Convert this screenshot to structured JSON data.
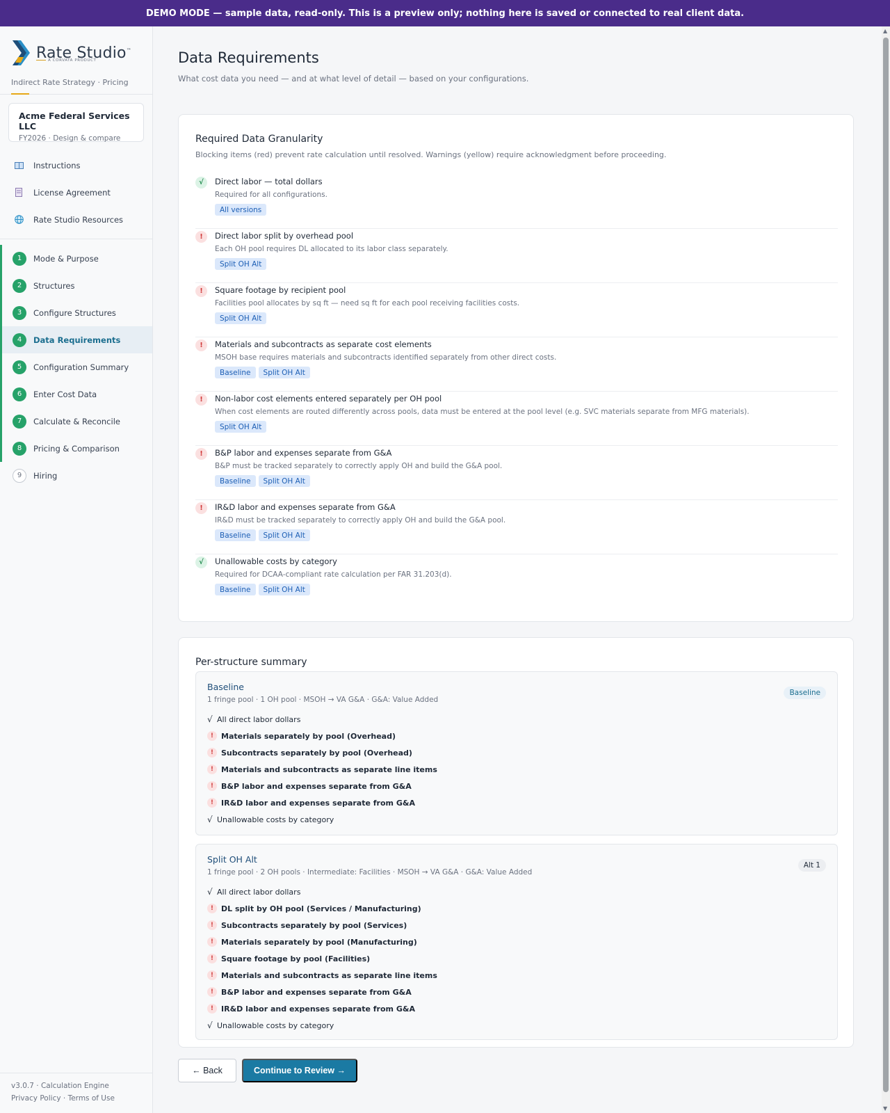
{
  "banner": "DEMO MODE — sample data, read-only. This is a preview only; nothing here is saved or connected to real client data.",
  "brand": {
    "name": "Rate Studio",
    "tm": "™",
    "sub": "A CORVATA PRODUCT",
    "tagline": "Indirect Rate Strategy · Pricing"
  },
  "client": {
    "name": "Acme Federal Services LLC",
    "sub": "FY2026 · Design & compare"
  },
  "resources": [
    {
      "label": "Instructions",
      "icon": "book-icon"
    },
    {
      "label": "License Agreement",
      "icon": "document-icon"
    },
    {
      "label": "Rate Studio Resources",
      "icon": "globe-icon"
    }
  ],
  "steps": [
    {
      "num": "1",
      "label": "Mode & Purpose"
    },
    {
      "num": "2",
      "label": "Structures"
    },
    {
      "num": "3",
      "label": "Configure Structures"
    },
    {
      "num": "4",
      "label": "Data Requirements"
    },
    {
      "num": "5",
      "label": "Configuration Summary"
    },
    {
      "num": "6",
      "label": "Enter Cost Data"
    },
    {
      "num": "7",
      "label": "Calculate & Reconcile"
    },
    {
      "num": "8",
      "label": "Pricing & Comparison"
    },
    {
      "num": "9",
      "label": "Hiring"
    }
  ],
  "footer": {
    "version": "v3.0.7 · Calculation Engine",
    "privacy": "Privacy Policy",
    "sep": "·",
    "terms": "Terms of Use"
  },
  "page": {
    "title": "Data Requirements",
    "subtitle": "What cost data you need — and at what level of detail — based on your configurations."
  },
  "granularity": {
    "title": "Required Data Granularity",
    "desc": "Blocking items (red) prevent rate calculation until resolved. Warnings (yellow) require acknowledgment before proceeding.",
    "items": [
      {
        "status": "ok",
        "mark": "√",
        "title": "Direct labor — total dollars",
        "desc": "Required for all configurations.",
        "tags": [
          "All versions"
        ]
      },
      {
        "status": "bad",
        "mark": "!",
        "title": "Direct labor split by overhead pool",
        "desc": "Each OH pool requires DL allocated to its labor class separately.",
        "tags": [
          "Split OH Alt"
        ]
      },
      {
        "status": "bad",
        "mark": "!",
        "title": "Square footage by recipient pool",
        "desc": "Facilities pool allocates by sq ft — need sq ft for each pool receiving facilities costs.",
        "tags": [
          "Split OH Alt"
        ]
      },
      {
        "status": "bad",
        "mark": "!",
        "title": "Materials and subcontracts as separate cost elements",
        "desc": "MSOH base requires materials and subcontracts identified separately from other direct costs.",
        "tags": [
          "Baseline",
          "Split OH Alt"
        ]
      },
      {
        "status": "bad",
        "mark": "!",
        "title": "Non-labor cost elements entered separately per OH pool",
        "desc": "When cost elements are routed differently across pools, data must be entered at the pool level (e.g. SVC materials separate from MFG materials).",
        "tags": [
          "Split OH Alt"
        ]
      },
      {
        "status": "bad",
        "mark": "!",
        "title": "B&P labor and expenses separate from G&A",
        "desc": "B&P must be tracked separately to correctly apply OH and build the G&A pool.",
        "tags": [
          "Baseline",
          "Split OH Alt"
        ]
      },
      {
        "status": "bad",
        "mark": "!",
        "title": "IR&D labor and expenses separate from G&A",
        "desc": "IR&D must be tracked separately to correctly apply OH and build the G&A pool.",
        "tags": [
          "Baseline",
          "Split OH Alt"
        ]
      },
      {
        "status": "ok",
        "mark": "√",
        "title": "Unallowable costs by category",
        "desc": "Required for DCAA-compliant rate calculation per FAR 31.203(d).",
        "tags": [
          "Baseline",
          "Split OH Alt"
        ]
      }
    ]
  },
  "summary": {
    "title": "Per-structure summary",
    "structures": [
      {
        "name": "Baseline",
        "meta": "1 fringe pool · 1 OH pool · MSOH → VA G&A · G&A: Value Added",
        "badge": "Baseline",
        "items": [
          {
            "status": "ok",
            "mark": "√",
            "label": "All direct labor dollars"
          },
          {
            "status": "bad",
            "mark": "!",
            "label": "Materials separately by pool (Overhead)"
          },
          {
            "status": "bad",
            "mark": "!",
            "label": "Subcontracts separately by pool (Overhead)"
          },
          {
            "status": "bad",
            "mark": "!",
            "label": "Materials and subcontracts as separate line items"
          },
          {
            "status": "bad",
            "mark": "!",
            "label": "B&P labor and expenses separate from G&A"
          },
          {
            "status": "bad",
            "mark": "!",
            "label": "IR&D labor and expenses separate from G&A"
          },
          {
            "status": "ok",
            "mark": "√",
            "label": "Unallowable costs by category"
          }
        ]
      },
      {
        "name": "Split OH Alt",
        "meta": "1 fringe pool · 2 OH pools · Intermediate: Facilities · MSOH → VA G&A · G&A: Value Added",
        "badge": "Alt 1",
        "items": [
          {
            "status": "ok",
            "mark": "√",
            "label": "All direct labor dollars"
          },
          {
            "status": "bad",
            "mark": "!",
            "label": "DL split by OH pool (Services / Manufacturing)"
          },
          {
            "status": "bad",
            "mark": "!",
            "label": "Subcontracts separately by pool (Services)"
          },
          {
            "status": "bad",
            "mark": "!",
            "label": "Materials separately by pool (Manufacturing)"
          },
          {
            "status": "bad",
            "mark": "!",
            "label": "Square footage by pool (Facilities)"
          },
          {
            "status": "bad",
            "mark": "!",
            "label": "Materials and subcontracts as separate line items"
          },
          {
            "status": "bad",
            "mark": "!",
            "label": "B&P labor and expenses separate from G&A"
          },
          {
            "status": "bad",
            "mark": "!",
            "label": "IR&D labor and expenses separate from G&A"
          },
          {
            "status": "ok",
            "mark": "√",
            "label": "Unallowable costs by category"
          }
        ]
      }
    ]
  },
  "actions": {
    "back": "← Back",
    "next": "Continue to Review →"
  },
  "colors": {
    "banner": "#4a2c8a",
    "accent": "#1b7aa3",
    "done": "#26a269",
    "blocking": "#d03b3b"
  }
}
